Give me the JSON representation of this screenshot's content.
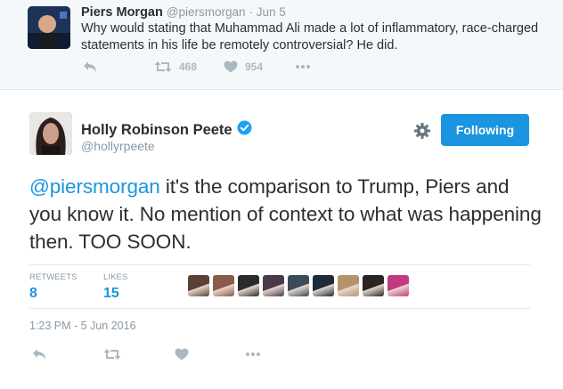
{
  "parent_tweet": {
    "name": "Piers Morgan",
    "handle": "@piersmorgan",
    "separator": "·",
    "date": "Jun 5",
    "text": "Why would stating that Muhammad Ali made a lot of inflammatory, race-charged statements in his life be remotely controversial? He did.",
    "retweets": "468",
    "likes": "954"
  },
  "tweet": {
    "name": "Holly Robinson Peete",
    "handle": "@hollyrpeete",
    "follow_label": "Following",
    "mention": "@piersmorgan",
    "text_rest": " it's the comparison to Trump, Piers and you know it. No mention of context to what was happening then. TOO SOON.",
    "retweets_label": "RETWEETS",
    "retweets": "8",
    "likes_label": "LIKES",
    "likes": "15",
    "timestamp": "1:23 PM - 5 Jun 2016",
    "likers": [
      "#5a4036",
      "#8a5a4a",
      "#2b2b2b",
      "#4a3a48",
      "#3c4a5a",
      "#1f2a38",
      "#b5936a",
      "#2a2424",
      "#c23a82"
    ]
  },
  "colors": {
    "accent": "#1b95e0",
    "muted": "#8899a6",
    "icon": "#aab8c2",
    "verified": "#1da1f2"
  },
  "icons": [
    "reply-icon",
    "retweet-icon",
    "like-icon",
    "more-icon",
    "gear-icon",
    "verified-badge-icon"
  ]
}
